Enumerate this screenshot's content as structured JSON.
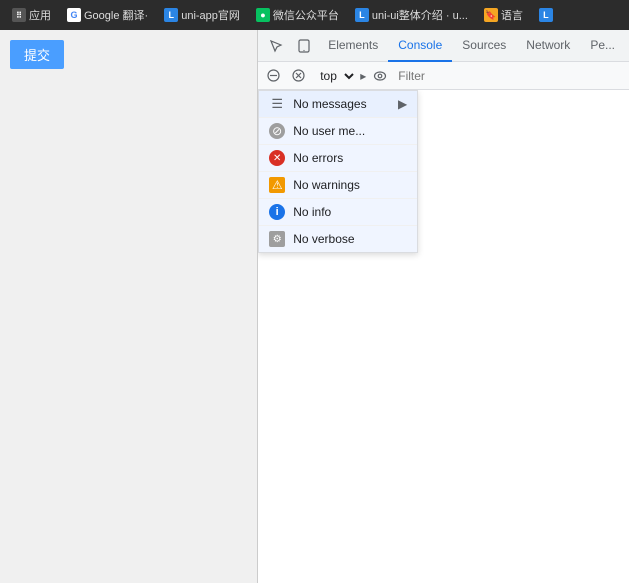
{
  "browser": {
    "tabs": [
      {
        "id": "apps",
        "icon_type": "apps",
        "icon_text": "⠿",
        "label": "应用"
      },
      {
        "id": "google",
        "icon_type": "google",
        "icon_text": "G",
        "label": "Google 翻译·"
      },
      {
        "id": "uni-app",
        "icon_type": "uni-app",
        "icon_text": "L",
        "label": "uni-app官网"
      },
      {
        "id": "wechat",
        "icon_type": "wechat",
        "icon_text": "●",
        "label": "微信公众平台"
      },
      {
        "id": "uni-ui",
        "icon_type": "uni-ui",
        "icon_text": "L",
        "label": "uni-ui整体介绍 · u..."
      },
      {
        "id": "lang",
        "icon_type": "lang",
        "icon_text": "🔖",
        "label": "语言"
      },
      {
        "id": "more",
        "icon_type": "lang",
        "icon_text": "L",
        "label": ""
      }
    ]
  },
  "left_panel": {
    "submit_button": "提交"
  },
  "devtools": {
    "tabs": [
      {
        "id": "elements",
        "label": "Elements",
        "active": false
      },
      {
        "id": "console",
        "label": "Console",
        "active": true
      },
      {
        "id": "sources",
        "label": "Sources",
        "active": false
      },
      {
        "id": "network",
        "label": "Network",
        "active": false
      },
      {
        "id": "performance",
        "label": "Pe...",
        "active": false
      }
    ],
    "toolbar": {
      "context_select": "top",
      "filter_placeholder": "Filter"
    },
    "filter_items": [
      {
        "id": "all",
        "icon_type": "list",
        "icon_text": "☰",
        "label": "No messages",
        "has_arrow": true
      },
      {
        "id": "user",
        "icon_type": "user",
        "icon_text": "⊘",
        "label": "No user me..."
      },
      {
        "id": "errors",
        "icon_type": "error",
        "icon_text": "✕",
        "label": "No errors"
      },
      {
        "id": "warnings",
        "icon_type": "warning",
        "icon_text": "⚠",
        "label": "No warnings"
      },
      {
        "id": "info",
        "icon_type": "info",
        "icon_text": "i",
        "label": "No info"
      },
      {
        "id": "verbose",
        "icon_type": "verbose",
        "icon_text": "⚙",
        "label": "No verbose"
      }
    ]
  }
}
